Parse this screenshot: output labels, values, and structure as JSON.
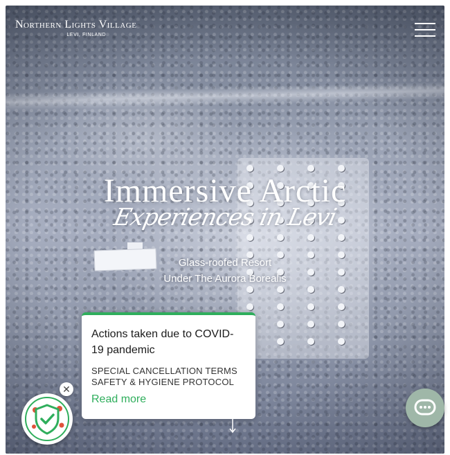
{
  "header": {
    "logo_title": "Northern Lights Village",
    "logo_subtitle": "LEVI, FINLAND",
    "menu_icon": "hamburger-menu-icon"
  },
  "hero": {
    "title": "Immersive Arctic",
    "script_line": "Experiences in Levi",
    "subtitle_line1": "Glass-roofed Resort",
    "subtitle_line2": "Under The Aurora Borealis"
  },
  "covid_popup": {
    "title": "Actions taken due to COVID-19 pandemic",
    "line1": "SPECIAL CANCELLATION TERMS",
    "line2": "SAFETY & HYGIENE PROTOCOL",
    "link": "Read more",
    "close_icon": "close-icon",
    "badge_icon": "shield-check-virus-icon"
  },
  "chat": {
    "icon": "chat-bubble-icon"
  },
  "scroll": {
    "icon": "arrow-down-icon"
  },
  "colors": {
    "accent": "#2fae5c",
    "chat": "#9fb7a8",
    "hero_text": "#ffffff"
  }
}
